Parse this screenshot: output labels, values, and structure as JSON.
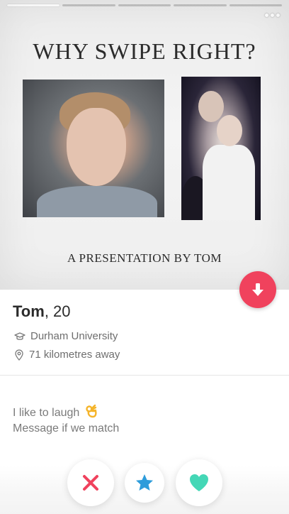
{
  "story": {
    "segments": 4,
    "active_segment": 1,
    "slide_title": "WHY SWIPE RIGHT?",
    "slide_subtitle": "A PRESENTATION BY TOM",
    "more_icon": "more-dots-icon"
  },
  "profile": {
    "name": "Tom",
    "age": ", 20",
    "school": "Durham University",
    "school_icon": "graduation-cap-icon",
    "distance": "71 kilometres away",
    "distance_icon": "location-pin-icon",
    "info_icon": "arrow-down-icon"
  },
  "bio": {
    "line1": "I like to laugh",
    "line1_emoji": "ok-hand-icon",
    "line2": "Message if we match"
  },
  "actions": {
    "nope": "x-icon",
    "super_like": "star-icon",
    "like": "heart-icon"
  },
  "colors": {
    "accent_red": "#f0425d",
    "nope_pink": "#f0425d",
    "super_blue": "#2d9cdb",
    "like_green": "#44d7b6"
  }
}
